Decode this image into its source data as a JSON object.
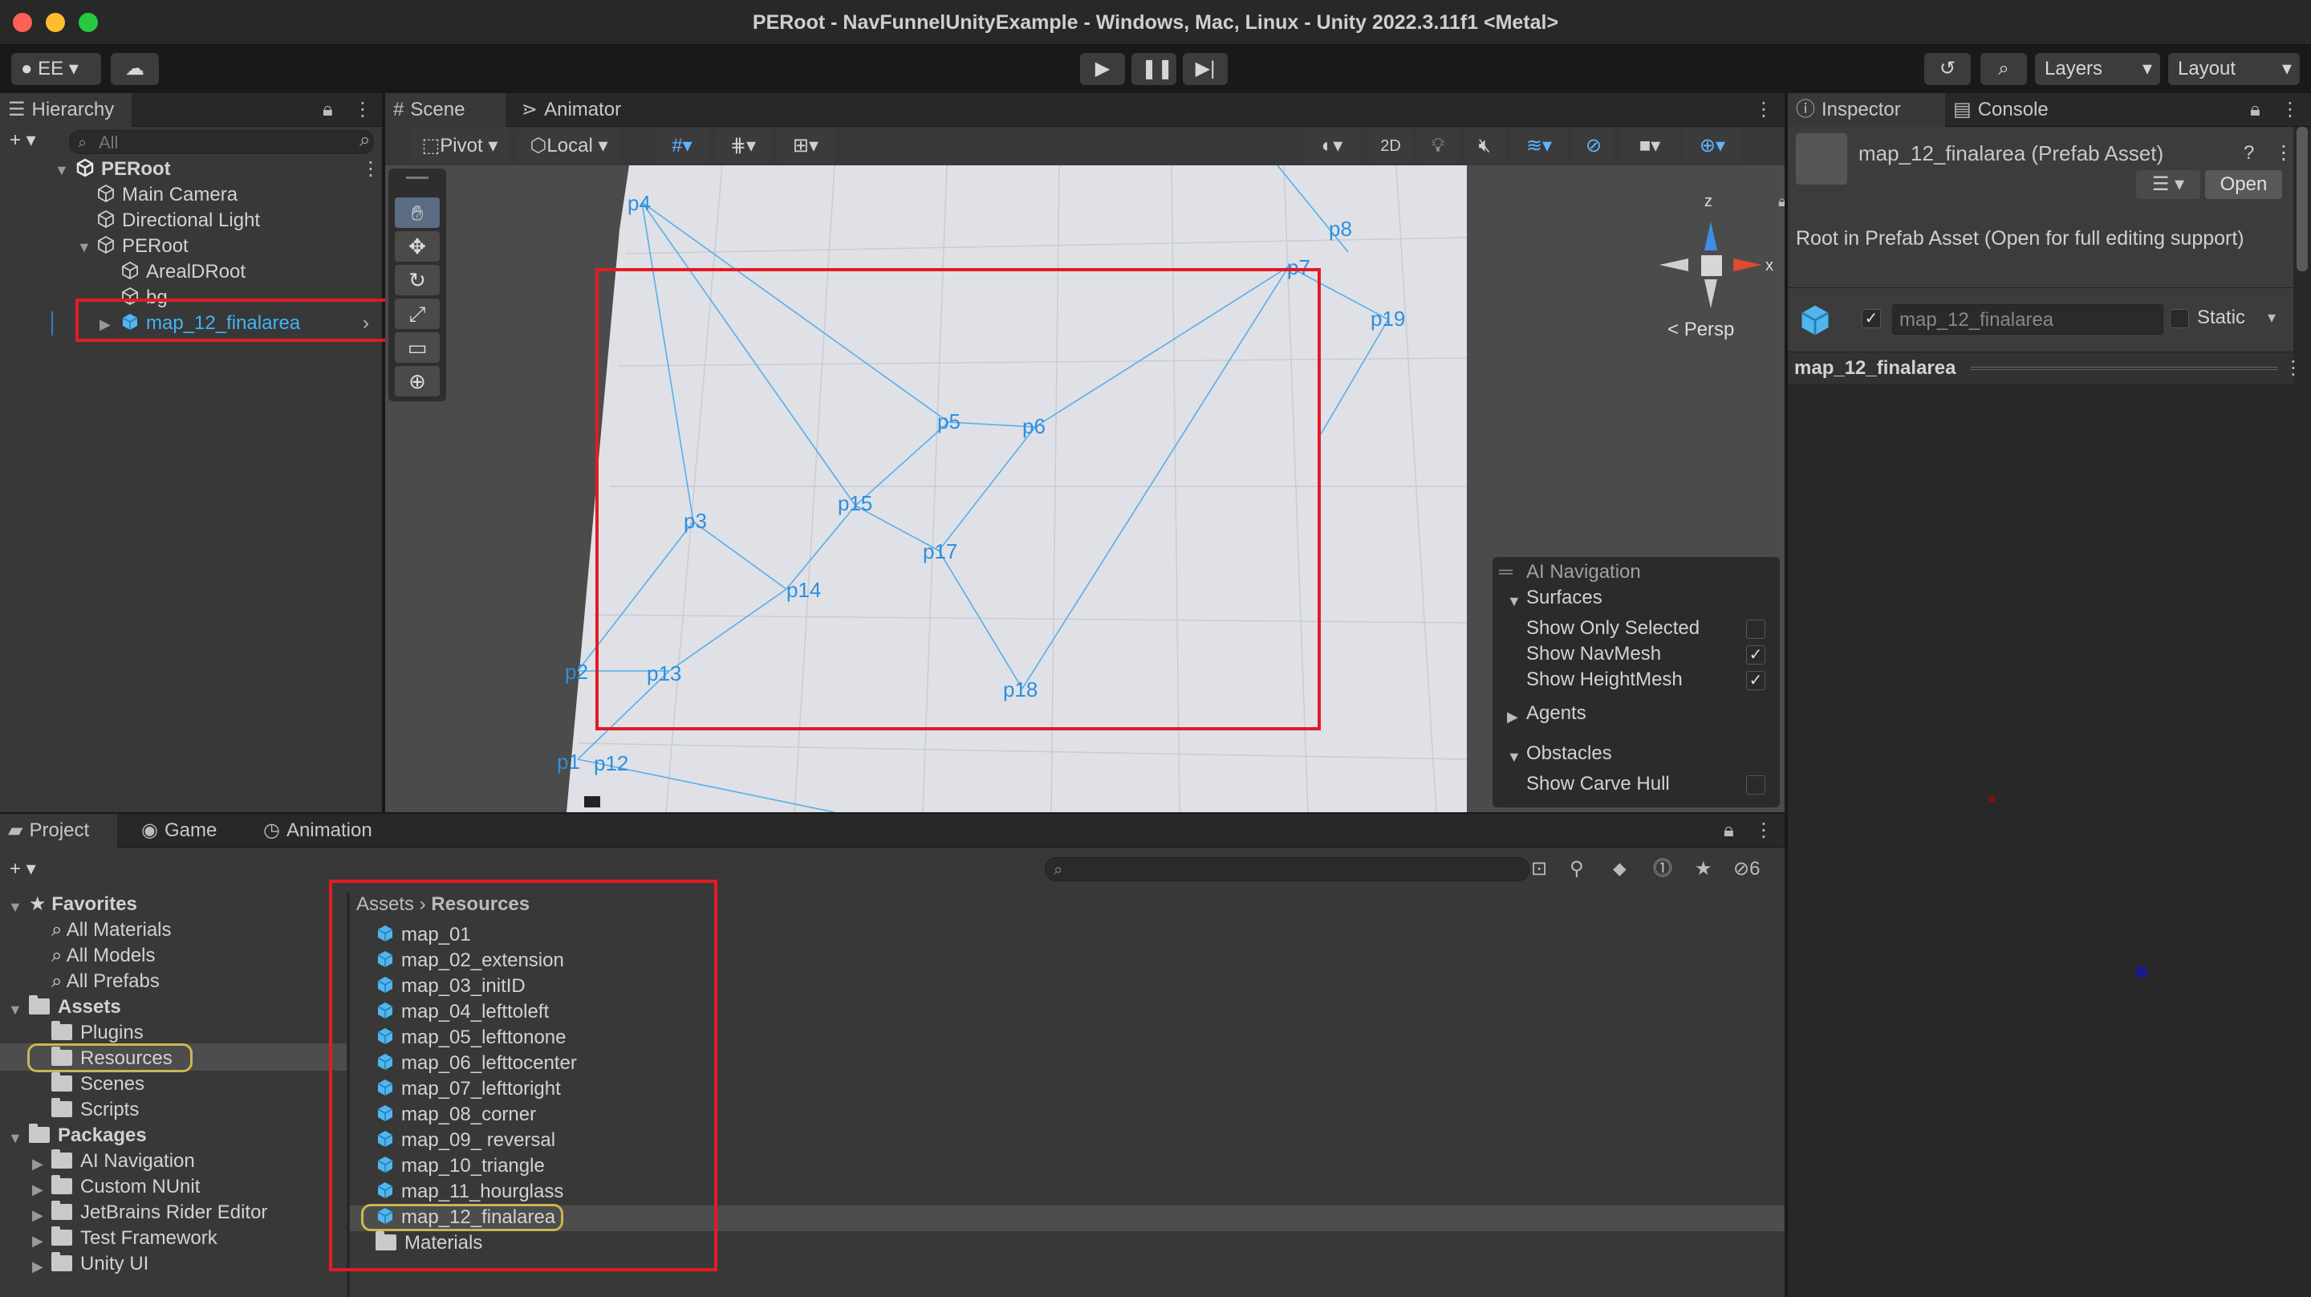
{
  "window": {
    "title": "PERoot - NavFunnelUnityExample - Windows, Mac, Linux - Unity 2022.3.11f1 <Metal>"
  },
  "toolbar": {
    "account": "EE",
    "layers": "Layers",
    "layout": "Layout"
  },
  "hierarchy": {
    "tab": "Hierarchy",
    "search_placeholder": "All",
    "items": [
      {
        "label": "PERoot"
      },
      {
        "label": "Main Camera"
      },
      {
        "label": "Directional Light"
      },
      {
        "label": "PERoot"
      },
      {
        "label": "ArealDRoot"
      },
      {
        "label": "bg"
      },
      {
        "label": "map_12_finalarea"
      }
    ]
  },
  "scene_view": {
    "tabs": [
      "Scene",
      "Animator"
    ],
    "pivot": "Pivot",
    "local": "Local",
    "mode_2d": "2D",
    "persp": "Persp",
    "gizmo_z": "z",
    "gizmo_x": "x",
    "points": [
      "p4",
      "p8",
      "p7",
      "p19",
      "p5",
      "p6",
      "p15",
      "p3",
      "p17",
      "p14",
      "p2",
      "p13",
      "p18",
      "p1",
      "p12"
    ],
    "overlay": {
      "title": "AI Navigation",
      "surfaces": "Surfaces",
      "show_only_selected": "Show Only Selected",
      "show_navmesh": "Show NavMesh",
      "show_heightmesh": "Show HeightMesh",
      "agents": "Agents",
      "obstacles": "Obstacles",
      "show_carve_hull": "Show Carve Hull"
    }
  },
  "inspector": {
    "tabs": [
      "Inspector",
      "Console"
    ],
    "asset_title": "map_12_finalarea (Prefab Asset)",
    "open_button": "Open",
    "root_note": "Root in Prefab Asset (Open for full editing support)",
    "name_field": "map_12_finalarea",
    "static_label": "Static",
    "section": "map_12_finalarea"
  },
  "project": {
    "tabs": [
      "Project",
      "Game",
      "Animation"
    ],
    "hidden_count": "6",
    "favorites": {
      "label": "Favorites",
      "items": [
        "All Materials",
        "All Models",
        "All Prefabs"
      ]
    },
    "assets": {
      "label": "Assets",
      "items": [
        "Plugins",
        "Resources",
        "Scenes",
        "Scripts"
      ]
    },
    "packages": {
      "label": "Packages",
      "items": [
        "AI Navigation",
        "Custom NUnit",
        "JetBrains Rider Editor",
        "Test Framework",
        "Unity UI"
      ]
    },
    "breadcrumb": [
      "Assets",
      "Resources"
    ],
    "files": [
      "map_01",
      "map_02_extension",
      "map_03_initID",
      "map_04_lefttoleft",
      "map_05_lefttonone",
      "map_06_lefttocenter",
      "map_07_lefttoright",
      "map_08_corner",
      "map_09_ reversal",
      "map_10_triangle",
      "map_11_hourglass",
      "map_12_finalarea",
      "Materials"
    ]
  },
  "colors": {
    "accent": "#3fb4f5",
    "highlight": "#e21b23",
    "selection": "#cbb64f"
  }
}
